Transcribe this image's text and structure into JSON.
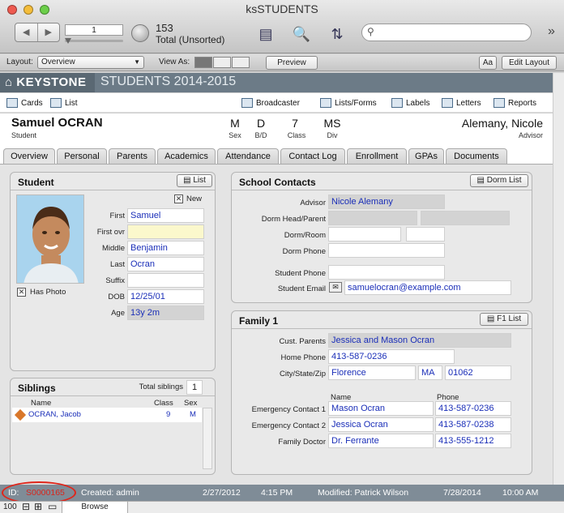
{
  "window": {
    "title": "ksSTUDENTS"
  },
  "toolbar": {
    "record_field": "1",
    "record_count": "153",
    "record_label": "Total (Unsorted)",
    "search_placeholder": ""
  },
  "layout_bar": {
    "layout_label": "Layout:",
    "layout_value": "Overview",
    "view_as_label": "View As:",
    "preview_label": "Preview",
    "font_btn": "Aa",
    "edit_layout_label": "Edit Layout"
  },
  "band": {
    "logo": "KEYSTONE",
    "title": "STUDENTS 2014-2015"
  },
  "nav": {
    "cards": "Cards",
    "list": "List",
    "broadcaster": "Broadcaster",
    "lists_forms": "Lists/Forms",
    "labels": "Labels",
    "letters": "Letters",
    "reports": "Reports"
  },
  "student_header": {
    "name": "Samuel OCRAN",
    "name_label": "Student",
    "sex": "M",
    "sex_label": "Sex",
    "bd": "D",
    "bd_label": "B/D",
    "class": "7",
    "class_label": "Class",
    "div": "MS",
    "div_label": "Div",
    "advisor": "Alemany, Nicole",
    "advisor_label": "Advisor"
  },
  "tabs": [
    "Overview",
    "Personal",
    "Parents",
    "Academics",
    "Attendance",
    "Contact Log",
    "Enrollment",
    "GPAs",
    "Documents"
  ],
  "student_panel": {
    "title": "Student",
    "list_btn": "List",
    "new_label": "New",
    "has_photo_label": "Has Photo",
    "fields": {
      "first_label": "First",
      "first": "Samuel",
      "firstovr_label": "First ovr",
      "firstovr": "",
      "middle_label": "Middle",
      "middle": "Benjamin",
      "last_label": "Last",
      "last": "Ocran",
      "suffix_label": "Suffix",
      "suffix": "",
      "dob_label": "DOB",
      "dob": "12/25/01",
      "age_label": "Age",
      "age": "13y 2m"
    }
  },
  "siblings_panel": {
    "title": "Siblings",
    "total_label": "Total siblings",
    "total": "1",
    "col_name": "Name",
    "col_class": "Class",
    "col_sex": "Sex",
    "rows": [
      {
        "name": "OCRAN, Jacob",
        "class": "9",
        "sex": "M"
      }
    ]
  },
  "contacts_panel": {
    "title": "School Contacts",
    "dorm_btn": "Dorm List",
    "advisor_label": "Advisor",
    "advisor": "Nicole Alemany",
    "dormhead_label": "Dorm Head/Parent",
    "dormroom_label": "Dorm/Room",
    "dormphone_label": "Dorm Phone",
    "sphone_label": "Student Phone",
    "semail_label": "Student Email",
    "semail": "samuelocran@example.com"
  },
  "family_panel": {
    "title": "Family 1",
    "f1_btn": "F1 List",
    "parents_label": "Cust. Parents",
    "parents": "Jessica and Mason Ocran",
    "homephone_label": "Home Phone",
    "homephone": "413-587-0236",
    "csz_label": "City/State/Zip",
    "city": "Florence",
    "state": "MA",
    "zip": "01062",
    "col_name": "Name",
    "col_phone": "Phone",
    "ec1_label": "Emergency Contact 1",
    "ec1_name": "Mason Ocran",
    "ec1_phone": "413-587-0236",
    "ec2_label": "Emergency Contact 2",
    "ec2_name": "Jessica Ocran",
    "ec2_phone": "413-587-0238",
    "doc_label": "Family Doctor",
    "doc_name": "Dr. Ferrante",
    "doc_phone": "413-555-1212"
  },
  "status": {
    "id_label": "ID:",
    "id": "S0000165",
    "created": "Created: admin",
    "created_date": "2/27/2012",
    "created_time": "4:15 PM",
    "modified": "Modified: Patrick Wilson",
    "modified_date": "7/28/2014",
    "modified_time": "10:00 AM"
  },
  "bottom": {
    "zoom": "100",
    "mode": "Browse"
  }
}
